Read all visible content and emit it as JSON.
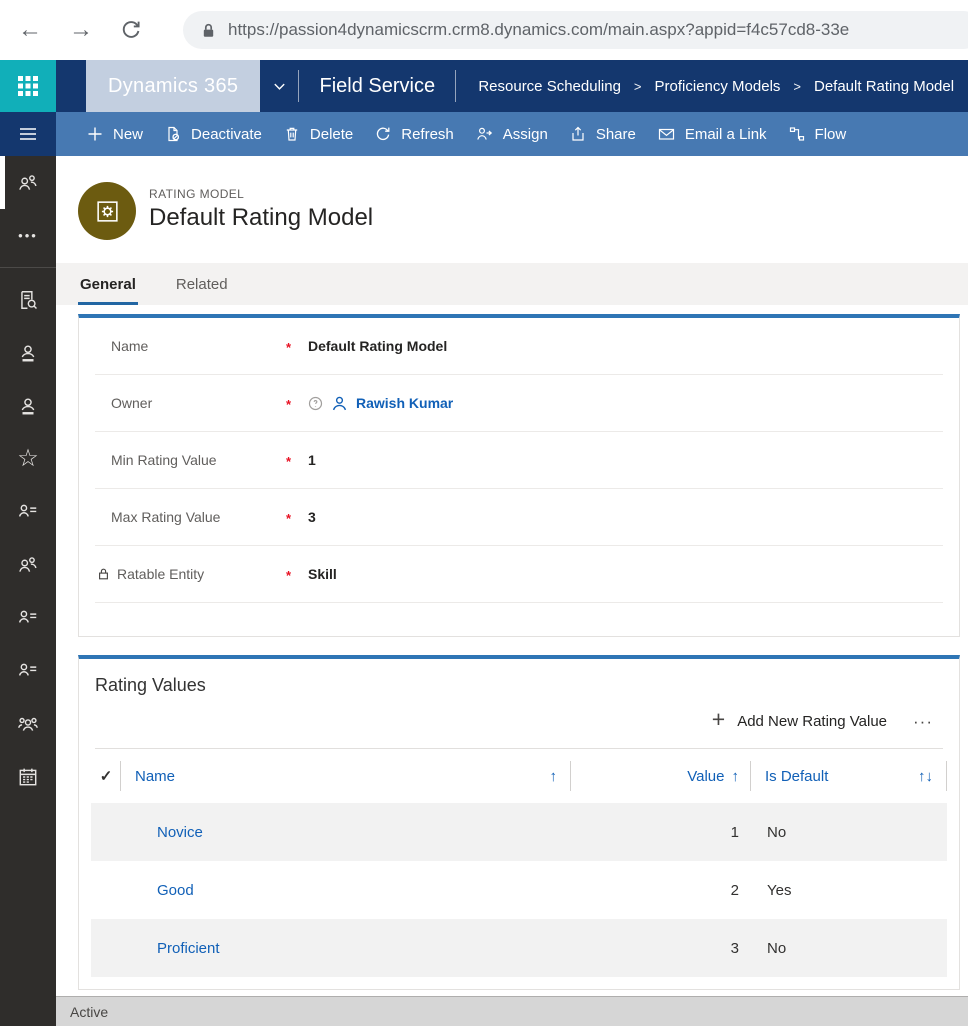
{
  "browser": {
    "url": "https://passion4dynamicscrm.crm8.dynamics.com/main.aspx?appid=f4c57cd8-33e"
  },
  "nav": {
    "app": "Dynamics 365",
    "module": "Field Service",
    "breadcrumb": [
      "Resource Scheduling",
      "Proficiency Models",
      "Default Rating Model"
    ]
  },
  "commands": {
    "items": [
      {
        "label": "New",
        "icon": "plus-icon"
      },
      {
        "label": "Deactivate",
        "icon": "deactivate-icon"
      },
      {
        "label": "Delete",
        "icon": "trash-icon"
      },
      {
        "label": "Refresh",
        "icon": "refresh-icon"
      },
      {
        "label": "Assign",
        "icon": "assign-person-icon"
      },
      {
        "label": "Share",
        "icon": "share-icon"
      },
      {
        "label": "Email a Link",
        "icon": "email-icon"
      },
      {
        "label": "Flow",
        "icon": "flow-icon"
      }
    ]
  },
  "sidebar": {
    "items": [
      {
        "icon": "people"
      },
      {
        "icon": "more-dots"
      },
      {
        "icon": "document-search"
      },
      {
        "icon": "contact"
      },
      {
        "icon": "contact"
      },
      {
        "icon": "star"
      },
      {
        "icon": "person-list"
      },
      {
        "icon": "people"
      },
      {
        "icon": "person-list"
      },
      {
        "icon": "person-list"
      },
      {
        "icon": "team"
      },
      {
        "icon": "calendar"
      }
    ]
  },
  "record": {
    "entity_label": "RATING MODEL",
    "title": "Default Rating Model",
    "tabs": [
      {
        "label": "General"
      },
      {
        "label": "Related"
      }
    ],
    "fields": [
      {
        "label": "Name",
        "required": "*",
        "value": "Default Rating Model"
      },
      {
        "label": "Owner",
        "required": "*",
        "value": "Rawish Kumar"
      },
      {
        "label": "Min Rating Value",
        "required": "*",
        "value": "1"
      },
      {
        "label": "Max Rating Value",
        "required": "*",
        "value": "3"
      },
      {
        "label": "Ratable Entity",
        "required": "*",
        "value": "Skill"
      }
    ]
  },
  "rating_values": {
    "title": "Rating Values",
    "add_label": "Add New Rating Value",
    "columns": [
      {
        "label": "Name"
      },
      {
        "label": "Value"
      },
      {
        "label": "Is Default"
      }
    ],
    "rows": [
      {
        "name": "Novice",
        "value": "1",
        "is_default": "No"
      },
      {
        "name": "Good",
        "value": "2",
        "is_default": "Yes"
      },
      {
        "name": "Proficient",
        "value": "3",
        "is_default": "No"
      }
    ]
  },
  "footer": {
    "status": "Active"
  },
  "glyphs": {
    "back": "←",
    "forward": "→",
    "plus": "+",
    "more": "···",
    "check": "✓",
    "sort_asc": "↑",
    "sort_both": "↑↓",
    "star": "☆",
    "dots": "•••",
    "crumb_sep": ">"
  },
  "colors": {
    "teal_accent": "#11AFB9",
    "nav_navy": "#14376E",
    "command_blue": "#4779B2",
    "link_blue": "#1160B7",
    "section_accent": "#2E75B5",
    "avatar_olive": "#6C5B10",
    "required_red": "#E81123"
  }
}
